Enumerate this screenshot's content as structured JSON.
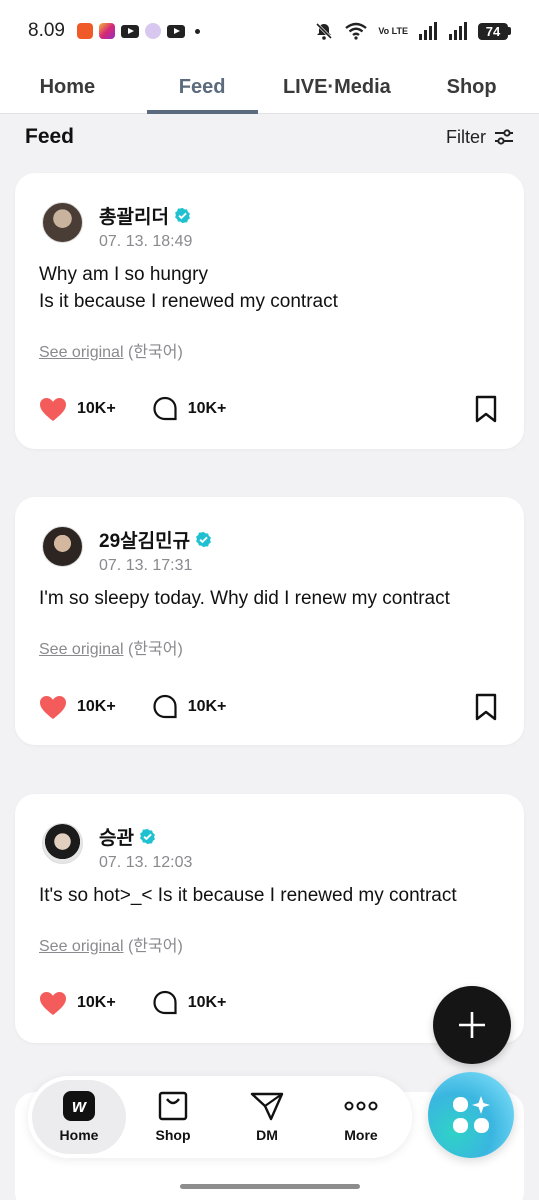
{
  "status_bar": {
    "time": "8.09",
    "battery": "74",
    "network_label": "Vo LTE"
  },
  "top_tabs": [
    {
      "label": "Home",
      "active": false
    },
    {
      "label": "Feed",
      "active": true
    },
    {
      "label": "LIVE·Media",
      "active": false
    },
    {
      "label": "Shop",
      "active": false
    }
  ],
  "feed_header": {
    "title": "Feed",
    "filter_label": "Filter"
  },
  "posts": [
    {
      "author": "총괄리더",
      "verified": true,
      "date": "07. 13. 18:49",
      "text": "Why am I so hungry\nIs it because I renewed my contract",
      "see_original": "See original",
      "language": "(한국어)",
      "likes": "10K+",
      "comments": "10K+"
    },
    {
      "author": "29살김민규",
      "verified": true,
      "date": "07. 13. 17:31",
      "text": "I'm so sleepy today. Why did I renew my contract",
      "see_original": "See original",
      "language": "(한국어)",
      "likes": "10K+",
      "comments": "10K+"
    },
    {
      "author": "승관",
      "verified": true,
      "date": "07. 13. 12:03",
      "text": "It's so hot>_< Is it because I renewed my contract",
      "see_original": "See original",
      "language": "(한국어)",
      "likes": "10K+",
      "comments": "10K+"
    }
  ],
  "bottom_nav": [
    {
      "label": "Home",
      "icon": "weverse-logo-icon",
      "active": true
    },
    {
      "label": "Shop",
      "icon": "shopping-bag-icon",
      "active": false
    },
    {
      "label": "DM",
      "icon": "send-icon",
      "active": false
    },
    {
      "label": "More",
      "icon": "more-dots-icon",
      "active": false
    }
  ],
  "colors": {
    "accent": "#5b6a7d",
    "heart": "#f45b5b",
    "verified": "#1fc0d0",
    "background": "#f2f2f4"
  }
}
